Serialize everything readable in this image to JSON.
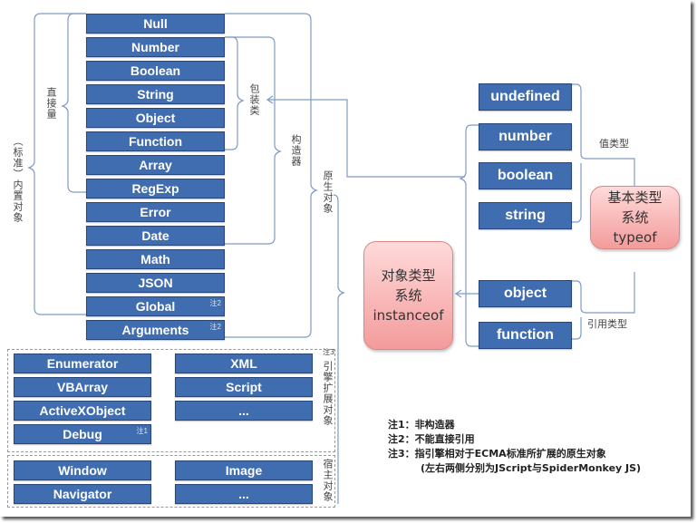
{
  "builtin_objects": [
    {
      "label": "Null",
      "note": ""
    },
    {
      "label": "Number",
      "note": ""
    },
    {
      "label": "Boolean",
      "note": ""
    },
    {
      "label": "String",
      "note": ""
    },
    {
      "label": "Object",
      "note": ""
    },
    {
      "label": "Function",
      "note": ""
    },
    {
      "label": "Array",
      "note": ""
    },
    {
      "label": "RegExp",
      "note": ""
    },
    {
      "label": "Error",
      "note": ""
    },
    {
      "label": "Date",
      "note": ""
    },
    {
      "label": "Math",
      "note": ""
    },
    {
      "label": "JSON",
      "note": ""
    },
    {
      "label": "Global",
      "note": "注2"
    },
    {
      "label": "Arguments",
      "note": "注2"
    }
  ],
  "group_labels": {
    "builtin": "（标准）内置对象",
    "literal": "直接量",
    "wrapper": "包装类",
    "constructor": "构造器",
    "native": "原生对象",
    "engine_ext": "引擎扩展对象",
    "engine_ext_note": "注3",
    "host": "宿主对象",
    "value_type": "值类型",
    "reference_type": "引用类型"
  },
  "engine_ext_left": [
    {
      "label": "Enumerator",
      "note": ""
    },
    {
      "label": "VBArray",
      "note": ""
    },
    {
      "label": "ActiveXObject",
      "note": ""
    },
    {
      "label": "Debug",
      "note": "注1"
    }
  ],
  "engine_ext_right": [
    {
      "label": "XML"
    },
    {
      "label": "Script"
    },
    {
      "label": "..."
    }
  ],
  "host_left": [
    {
      "label": "Window"
    },
    {
      "label": "Navigator"
    }
  ],
  "host_right": [
    {
      "label": "Image"
    },
    {
      "label": "..."
    }
  ],
  "typeof_values": [
    {
      "label": "undefined"
    },
    {
      "label": "number"
    },
    {
      "label": "boolean"
    },
    {
      "label": "string"
    },
    {
      "label": "object"
    },
    {
      "label": "function"
    }
  ],
  "primitive_system": {
    "line1": "基本类型",
    "line2": "系统",
    "line3": "typeof"
  },
  "object_system": {
    "line1": "对象类型",
    "line2": "系统",
    "line3": "instanceof"
  },
  "notes": [
    "注1：非构造器",
    "注2：不能直接引用",
    "注3：指引擎相对于ECMA标准所扩展的原生对象",
    "(左右两侧分别为JScript与SpiderMonkey JS)"
  ],
  "colors": {
    "box": "#3f6db0",
    "pink": "#f39b9b",
    "line": "#7f9cc4"
  }
}
